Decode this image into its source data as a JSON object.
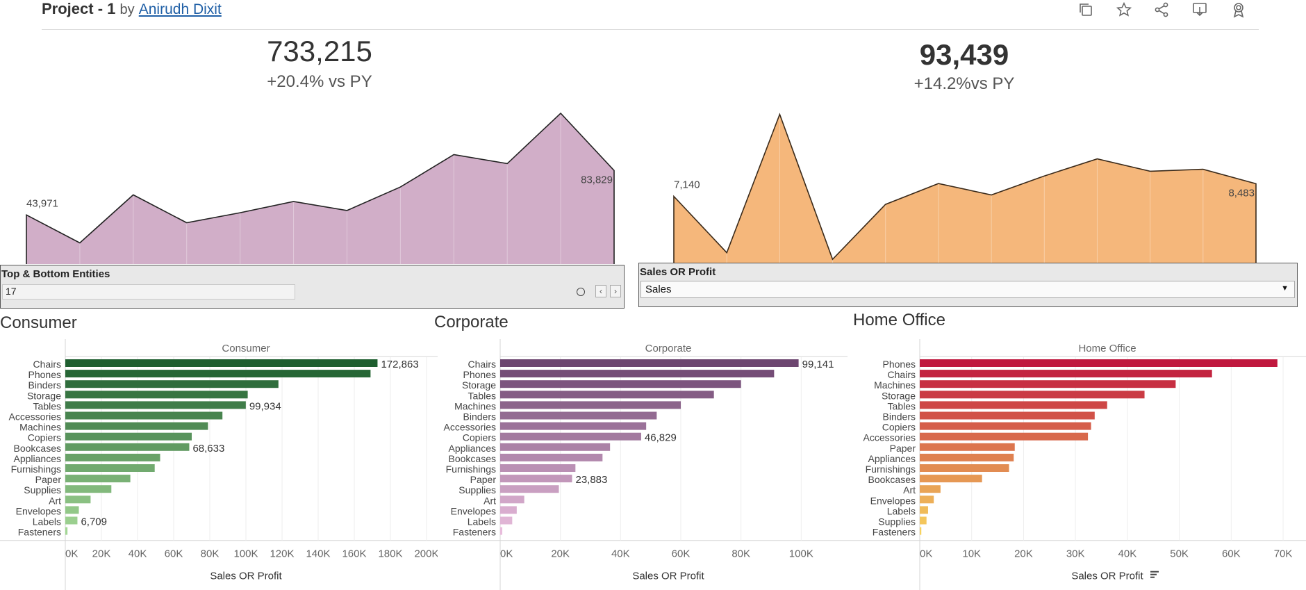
{
  "header": {
    "title": "Project - 1",
    "by": "by",
    "author": "Anirudh Dixit",
    "tools": [
      "duplicate-icon",
      "star-icon",
      "share-icon",
      "download-icon",
      "award-icon"
    ]
  },
  "kpis": [
    {
      "value": "733,215",
      "delta": "+20.4% vs PY"
    },
    {
      "value": "93,439",
      "delta": "+14.2%vs PY"
    }
  ],
  "sparklines": [
    {
      "label_first": "43,971",
      "label_last": "83,829",
      "fill": "#d1aec8",
      "stroke": "#222222",
      "values": [
        43971,
        19000,
        62000,
        37000,
        46000,
        56000,
        48000,
        69000,
        98000,
        90000,
        135000,
        83829
      ]
    },
    {
      "label_first": "7,140",
      "label_last": "8,483",
      "fill": "#f5b77b",
      "stroke": "#3a2a1a",
      "values": [
        7140,
        1200,
        15800,
        500,
        6300,
        8500,
        7300,
        9300,
        11100,
        9800,
        10000,
        8483
      ]
    }
  ],
  "filters": {
    "top_bottom": {
      "title": "Top & Bottom Entities",
      "value": "17"
    },
    "measure": {
      "title": "Sales OR Profit",
      "selected": "Sales"
    }
  },
  "segments": [
    {
      "title": "Consumer",
      "header": "Consumer",
      "xlabel": "Sales OR Profit",
      "ticks": [
        "0K",
        "20K",
        "40K",
        "60K",
        "80K",
        "100K",
        "120K",
        "140K",
        "160K",
        "180K",
        "200K"
      ],
      "xmax": 200000,
      "colors": [
        "#1e5e2f",
        "#a3d795"
      ]
    },
    {
      "title": "Corporate",
      "header": "Corporate",
      "xlabel": "Sales OR Profit",
      "ticks": [
        "0K",
        "20K",
        "40K",
        "60K",
        "80K",
        "100K"
      ],
      "xmax": 120000,
      "colors": [
        "#6d4670",
        "#e8bcdc"
      ]
    },
    {
      "title": "Home Office",
      "header": "Home Office",
      "xlabel": "Sales OR Profit",
      "ticks": [
        "0K",
        "10K",
        "20K",
        "30K",
        "40K",
        "50K",
        "60K",
        "70K"
      ],
      "xmax": 72000,
      "colors": [
        "#c0183e",
        "#f7d25e"
      ]
    }
  ],
  "chart_data": [
    {
      "type": "bar",
      "title": "Consumer",
      "xlabel": "Sales OR Profit",
      "xlim": [
        0,
        200000
      ],
      "categories": [
        "Chairs",
        "Phones",
        "Binders",
        "Storage",
        "Tables",
        "Accessories",
        "Machines",
        "Copiers",
        "Bookcases",
        "Appliances",
        "Furnishings",
        "Paper",
        "Supplies",
        "Art",
        "Envelopes",
        "Labels",
        "Fasteners"
      ],
      "values": [
        172863,
        169000,
        118000,
        101000,
        99934,
        87000,
        79000,
        70000,
        68633,
        52500,
        49500,
        36000,
        25500,
        14000,
        7500,
        6709,
        1200
      ],
      "data_labels": {
        "0": "172,863",
        "4": "99,934",
        "8": "68,633",
        "15": "6,709"
      }
    },
    {
      "type": "bar",
      "title": "Corporate",
      "xlabel": "Sales OR Profit",
      "xlim": [
        0,
        120000
      ],
      "categories": [
        "Chairs",
        "Phones",
        "Storage",
        "Tables",
        "Machines",
        "Binders",
        "Accessories",
        "Copiers",
        "Appliances",
        "Bookcases",
        "Furnishings",
        "Paper",
        "Supplies",
        "Art",
        "Envelopes",
        "Labels",
        "Fasteners"
      ],
      "values": [
        99141,
        91000,
        80000,
        71000,
        60000,
        52000,
        48500,
        46829,
        36500,
        34000,
        25000,
        23883,
        19500,
        8000,
        5500,
        4000,
        700
      ],
      "data_labels": {
        "0": "99,141",
        "7": "46,829",
        "11": "23,883"
      }
    },
    {
      "type": "bar",
      "title": "Home Office",
      "xlabel": "Sales OR Profit",
      "xlim": [
        0,
        72000
      ],
      "categories": [
        "Phones",
        "Chairs",
        "Machines",
        "Storage",
        "Tables",
        "Binders",
        "Copiers",
        "Accessories",
        "Paper",
        "Appliances",
        "Furnishings",
        "Bookcases",
        "Art",
        "Envelopes",
        "Labels",
        "Supplies",
        "Fasteners"
      ],
      "values": [
        68900,
        56300,
        49300,
        43300,
        36100,
        33700,
        33000,
        32400,
        18300,
        18100,
        17200,
        12000,
        4000,
        2700,
        1600,
        1300,
        300
      ],
      "data_labels": {}
    }
  ]
}
